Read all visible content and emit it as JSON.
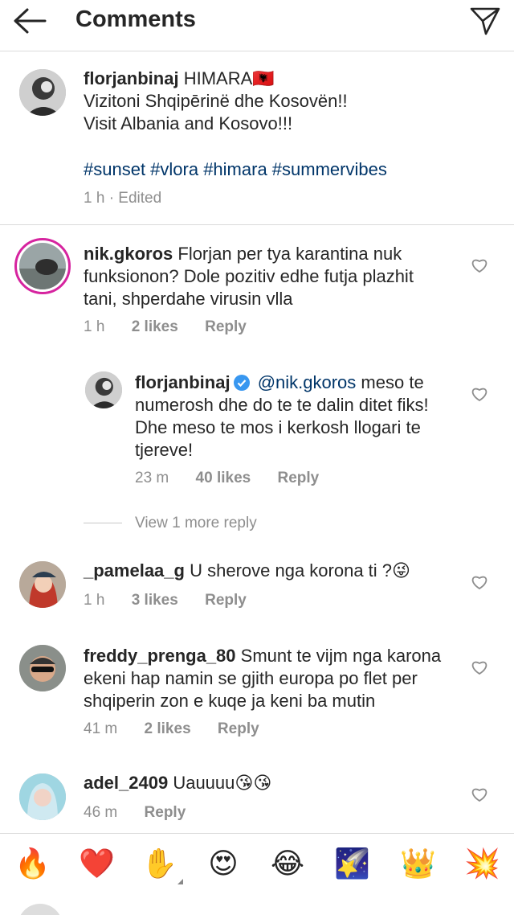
{
  "header": {
    "title": "Comments"
  },
  "caption": {
    "username": "florjanbinaj",
    "line1": "HIMARA🇦🇱",
    "line2": "Vizitoni Shqipērinë dhe Kosovën!!",
    "line3": "Visit Albania and Kosovo!!!",
    "hashtags": "#sunset #vlora #himara #summervibes",
    "time": "1 h · Edited"
  },
  "comments": [
    {
      "username": "nik.gkoros",
      "text_l1": "Florjan per tya karantina nuk",
      "text_l2": "funksionon? Dole pozitiv edhe futja plazhit",
      "text_l3": "tani, shperdahe virusin vlla",
      "time": "1 h",
      "likes": "2 likes",
      "reply": "Reply"
    },
    {
      "username": "florjanbinaj",
      "mention": "@nik.gkoros",
      "text_l1": "meso te",
      "text_l2": "numerosh dhe do te te dalin ditet fiks!",
      "text_l3": "Dhe meso te mos i kerkosh llogari te",
      "text_l4": "tjereve!",
      "time": "23 m",
      "likes": "40 likes",
      "reply": "Reply"
    },
    {
      "username": "_pamelaa_g",
      "text_l1": "U sherove nga korona ti ?😜",
      "time": "1 h",
      "likes": "3 likes",
      "reply": "Reply"
    },
    {
      "username": "freddy_prenga_80",
      "text_l1": "Smunt te vijm nga karona",
      "text_l2": "ekeni hap namin se gjith europa po flet per",
      "text_l3": "shqiperin zon e kuqe ja keni ba mutin",
      "time": "41 m",
      "likes": "2 likes",
      "reply": "Reply"
    },
    {
      "username": "adel_2409",
      "text_l1": "Uauuuu😘😘",
      "time": "46 m",
      "reply": "Reply"
    }
  ],
  "view_more": "View 1 more reply",
  "emoji_bar": [
    "🔥",
    "❤️",
    "✋",
    "😍",
    "😂",
    "🌠",
    "👑",
    "💥"
  ],
  "colors": {
    "link": "#003569",
    "muted": "#8e8e8e",
    "ring": "#d6249f",
    "verified": "#3897f0"
  }
}
